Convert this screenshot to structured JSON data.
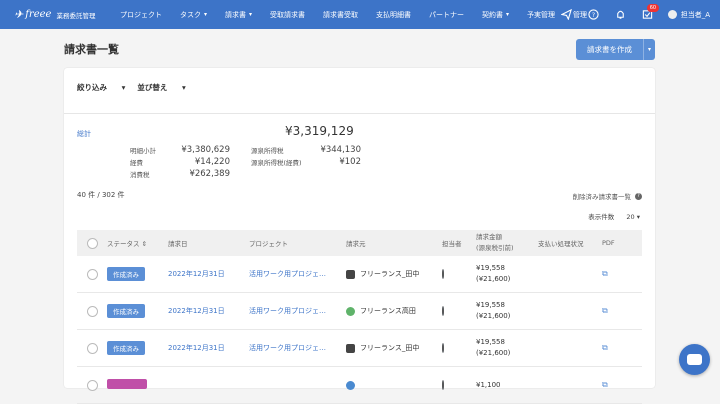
{
  "nav": {
    "logo_mark": "✈",
    "brand": "freee",
    "sub": "業務委託管理",
    "items": [
      {
        "label": "プロジェクト",
        "chevron": false
      },
      {
        "label": "タスク",
        "chevron": true
      },
      {
        "label": "請求書",
        "chevron": true
      },
      {
        "label": "受取請求書",
        "chevron": false
      },
      {
        "label": "請求書受取",
        "chevron": false
      },
      {
        "label": "支払明細書",
        "chevron": false
      },
      {
        "label": "パートナー",
        "chevron": false
      },
      {
        "label": "契約書",
        "chevron": true
      },
      {
        "label": "予実管理",
        "chevron": false
      },
      {
        "label": "管理",
        "chevron": false
      }
    ],
    "badge_count": "60",
    "user": "担当者_A"
  },
  "header": {
    "title": "請求書一覧",
    "create_label": "請求書を作成"
  },
  "filters": {
    "filter_label": "絞り込み",
    "sort_label": "並び替え"
  },
  "summary": {
    "label": "総計",
    "total": "¥3,319,129",
    "left": [
      {
        "k": "明細小計",
        "v": "¥3,380,629"
      },
      {
        "k": "経費",
        "v": "¥14,220"
      },
      {
        "k": "消費税",
        "v": "¥262,389"
      }
    ],
    "right": [
      {
        "k": "源泉所得税",
        "v": "¥344,130"
      },
      {
        "k": "源泉所得税(経費)",
        "v": "¥102"
      }
    ]
  },
  "list": {
    "count": "40 件 / 302 件",
    "deleted_label": "削除済み請求書一覧",
    "per_page_label": "表示件数",
    "per_page_value": "20"
  },
  "table": {
    "headers": {
      "status": "ステータス",
      "date": "請求日",
      "project": "プロジェクト",
      "client": "請求元",
      "assignee": "担当者",
      "amount_1": "請求金額",
      "amount_2": "(源泉税引前)",
      "payment": "支払い処理状況",
      "pdf": "PDF"
    },
    "rows": [
      {
        "status": "作成済み",
        "date": "2022年12月31日",
        "project": "活用ワーク用プロジェ…",
        "client": "フリーランス_田中",
        "icon": "group",
        "amount": "¥19,558",
        "amount_sub": "(¥21,600)"
      },
      {
        "status": "作成済み",
        "date": "2022年12月31日",
        "project": "活用ワーク用プロジェ…",
        "client": "フリーランス高田",
        "icon": "green",
        "amount": "¥19,558",
        "amount_sub": "(¥21,600)"
      },
      {
        "status": "作成済み",
        "date": "2022年12月31日",
        "project": "活用ワーク用プロジェ…",
        "client": "フリーランス_田中",
        "icon": "group",
        "amount": "¥19,558",
        "amount_sub": "(¥21,600)"
      },
      {
        "status": "",
        "date": "",
        "project": "",
        "client": "",
        "icon": "blue",
        "amount": "¥1,100",
        "amount_sub": ""
      }
    ]
  }
}
